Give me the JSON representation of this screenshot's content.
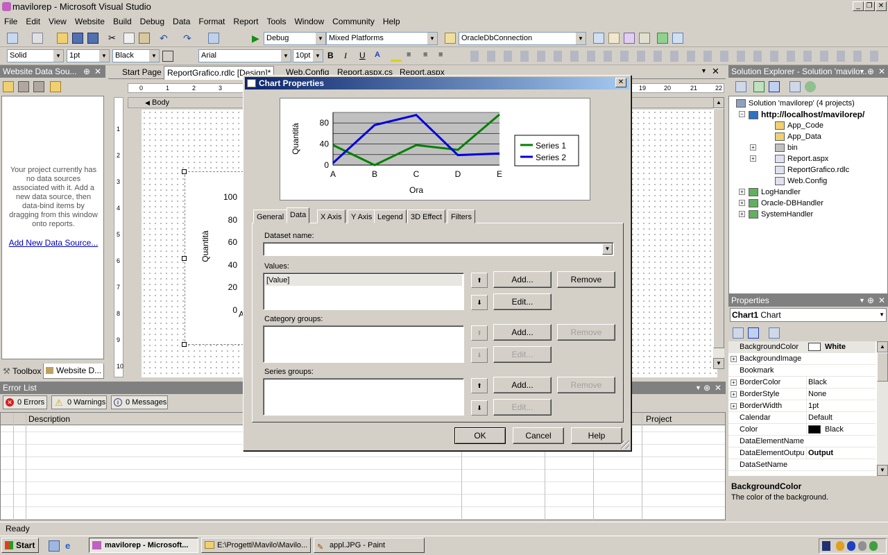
{
  "window": {
    "title": "mavilorep - Microsoft Visual Studio"
  },
  "menu": [
    "File",
    "Edit",
    "View",
    "Website",
    "Build",
    "Debug",
    "Data",
    "Format",
    "Report",
    "Tools",
    "Window",
    "Community",
    "Help"
  ],
  "toolbar1": {
    "config": "Debug",
    "platform": "Mixed Platforms",
    "connection": "OracleDbConnection"
  },
  "toolbar2": {
    "border_style": "Solid",
    "border_width": "1pt",
    "color": "Black",
    "font": "Arial",
    "font_size": "10pt",
    "bold": "B",
    "italic": "I",
    "underline": "U"
  },
  "datasources": {
    "title": "Website Data Sou...",
    "message": "Your project currently has no data sources associated with it. Add a new data source, then data-bind items by dragging from this window onto reports.",
    "link": "Add New Data Source...",
    "tabs": [
      "Toolbox",
      "Website D..."
    ]
  },
  "doc_tabs": [
    "Start Page",
    "ReportGrafico.rdlc [Design]*",
    "Web.Config",
    "Report.aspx.cs",
    "Report.aspx"
  ],
  "designer": {
    "body_label": "Body",
    "ruler_labels": [
      "0",
      "1",
      "2",
      "3",
      "19",
      "20",
      "21",
      "22"
    ],
    "vruler": [
      "1",
      "2",
      "3",
      "4",
      "5",
      "6",
      "7",
      "8",
      "9",
      "10"
    ],
    "bg_chart": {
      "ylabel": "Quantità",
      "yticks": [
        "100",
        "80",
        "60",
        "40",
        "20",
        "0"
      ],
      "xfirst": "A"
    }
  },
  "dialog": {
    "title": "Chart Properties",
    "tabs": [
      "General",
      "Data",
      "X Axis",
      "Y Axis",
      "Legend",
      "3D Effect",
      "Filters"
    ],
    "active_tab": "Data",
    "dataset_label": "Dataset name:",
    "dataset_value": "",
    "values_label": "Values:",
    "values_items": [
      "[Value]"
    ],
    "category_label": "Category groups:",
    "series_label": "Series groups:",
    "add": "Add...",
    "edit": "Edit...",
    "remove": "Remove",
    "ok": "OK",
    "cancel": "Cancel",
    "help": "Help"
  },
  "chart_data": {
    "type": "line",
    "categories": [
      "A",
      "B",
      "C",
      "D",
      "E"
    ],
    "series": [
      {
        "name": "Series 1",
        "values": [
          38,
          0,
          38,
          29,
          96
        ],
        "color": "#008000"
      },
      {
        "name": "Series 2",
        "values": [
          4,
          76,
          95,
          19,
          22
        ],
        "color": "#0000e0"
      }
    ],
    "ylabel": "Quantità",
    "xlabel": "Ora",
    "yticks": [
      0,
      40,
      80
    ],
    "ylim": [
      0,
      100
    ],
    "grid": true,
    "legend": "right"
  },
  "solution_explorer": {
    "title": "Solution Explorer - Solution 'mavilo...",
    "items": [
      {
        "label": "Solution 'mavilorep' (4 projects)",
        "bold": false
      },
      {
        "label": "http://localhost/mavilorep/",
        "bold": true
      },
      {
        "label": "App_Code"
      },
      {
        "label": "App_Data"
      },
      {
        "label": "bin"
      },
      {
        "label": "Report.aspx"
      },
      {
        "label": "ReportGrafico.rdlc"
      },
      {
        "label": "Web.Config"
      },
      {
        "label": "LogHandler"
      },
      {
        "label": "Oracle-DBHandler"
      },
      {
        "label": "SystemHandler"
      }
    ]
  },
  "properties": {
    "title": "Properties",
    "object": "Chart1",
    "object_type": "Chart",
    "rows": [
      {
        "name": "BackgroundColor",
        "value": "White",
        "swatch": "#ffffff",
        "bold": true
      },
      {
        "name": "BackgroundImage",
        "value": "",
        "expand": true
      },
      {
        "name": "Bookmark",
        "value": ""
      },
      {
        "name": "BorderColor",
        "value": "Black",
        "expand": true
      },
      {
        "name": "BorderStyle",
        "value": "None",
        "expand": true
      },
      {
        "name": "BorderWidth",
        "value": "1pt",
        "expand": true
      },
      {
        "name": "Calendar",
        "value": "Default"
      },
      {
        "name": "Color",
        "value": "Black",
        "swatch": "#000000"
      },
      {
        "name": "DataElementName",
        "value": ""
      },
      {
        "name": "DataElementOutpu",
        "value": "Output",
        "bold": true
      },
      {
        "name": "DataSetName",
        "value": ""
      }
    ],
    "desc_title": "BackgroundColor",
    "desc_text": "The color of the background."
  },
  "error_list": {
    "title": "Error List",
    "errors": "0 Errors",
    "warnings": "0 Warnings",
    "messages": "0 Messages",
    "col_description": "Description",
    "col_project": "Project"
  },
  "status": "Ready",
  "taskbar": {
    "start": "Start",
    "items": [
      "mavilorep - Microsoft...",
      "E:\\Progetti\\Mavilo\\Mavilo...",
      "appl.JPG - Paint"
    ]
  }
}
